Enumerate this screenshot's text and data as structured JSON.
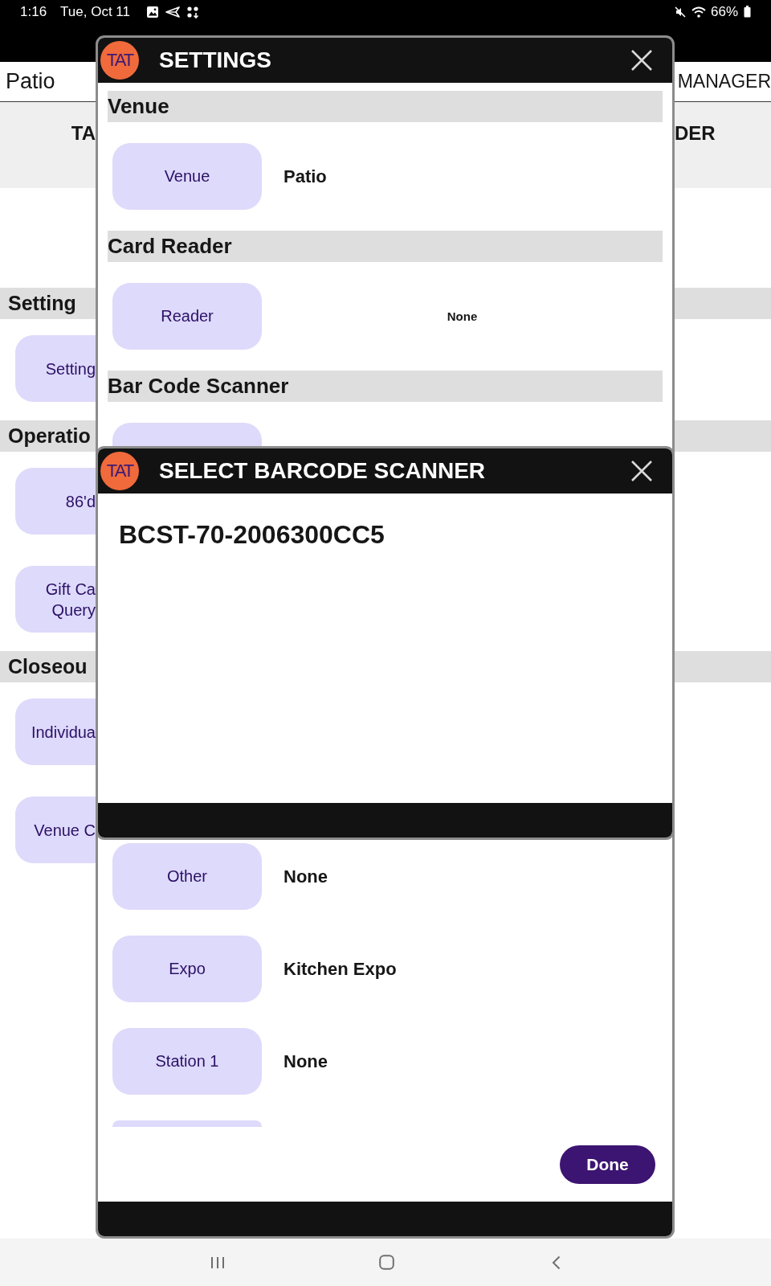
{
  "status_bar": {
    "time": "1:16",
    "date": "Tue, Oct 11",
    "battery": "66%"
  },
  "background": {
    "venue": "Patio",
    "role": "MANAGER",
    "tab_left": "TA",
    "tab_right": "DER",
    "sections": [
      {
        "title": "Setting",
        "buttons": [
          "Setting"
        ]
      },
      {
        "title": "Operatio",
        "buttons": [
          "86'd",
          "Gift Ca Query"
        ]
      },
      {
        "title": "Closeou",
        "buttons": [
          "Individua",
          "Venue C"
        ]
      }
    ]
  },
  "settings_dialog": {
    "logo": "TAT",
    "title": "SETTINGS",
    "sections": [
      {
        "title": "Venue",
        "rows": [
          {
            "kind": "value",
            "button": "Venue",
            "value": "Patio"
          }
        ]
      },
      {
        "title": "Card Reader",
        "rows": [
          {
            "kind": "centered",
            "button": "Reader",
            "value": "None"
          }
        ]
      },
      {
        "title": "Bar Code Scanner",
        "rows": [
          {
            "kind": "cut"
          }
        ]
      }
    ],
    "rows_below": [
      {
        "kind": "value",
        "button": "Other",
        "value": "None"
      },
      {
        "kind": "value",
        "button": "Expo",
        "value": "Kitchen Expo"
      },
      {
        "kind": "value",
        "button": "Station 1",
        "value": "None"
      },
      {
        "kind": "cut"
      }
    ],
    "done_button": "Done"
  },
  "scanner_dialog": {
    "logo": "TAT",
    "title": "SELECT BARCODE SCANNER",
    "devices": [
      {
        "name": "BCST-70-2006300CC5"
      }
    ]
  }
}
